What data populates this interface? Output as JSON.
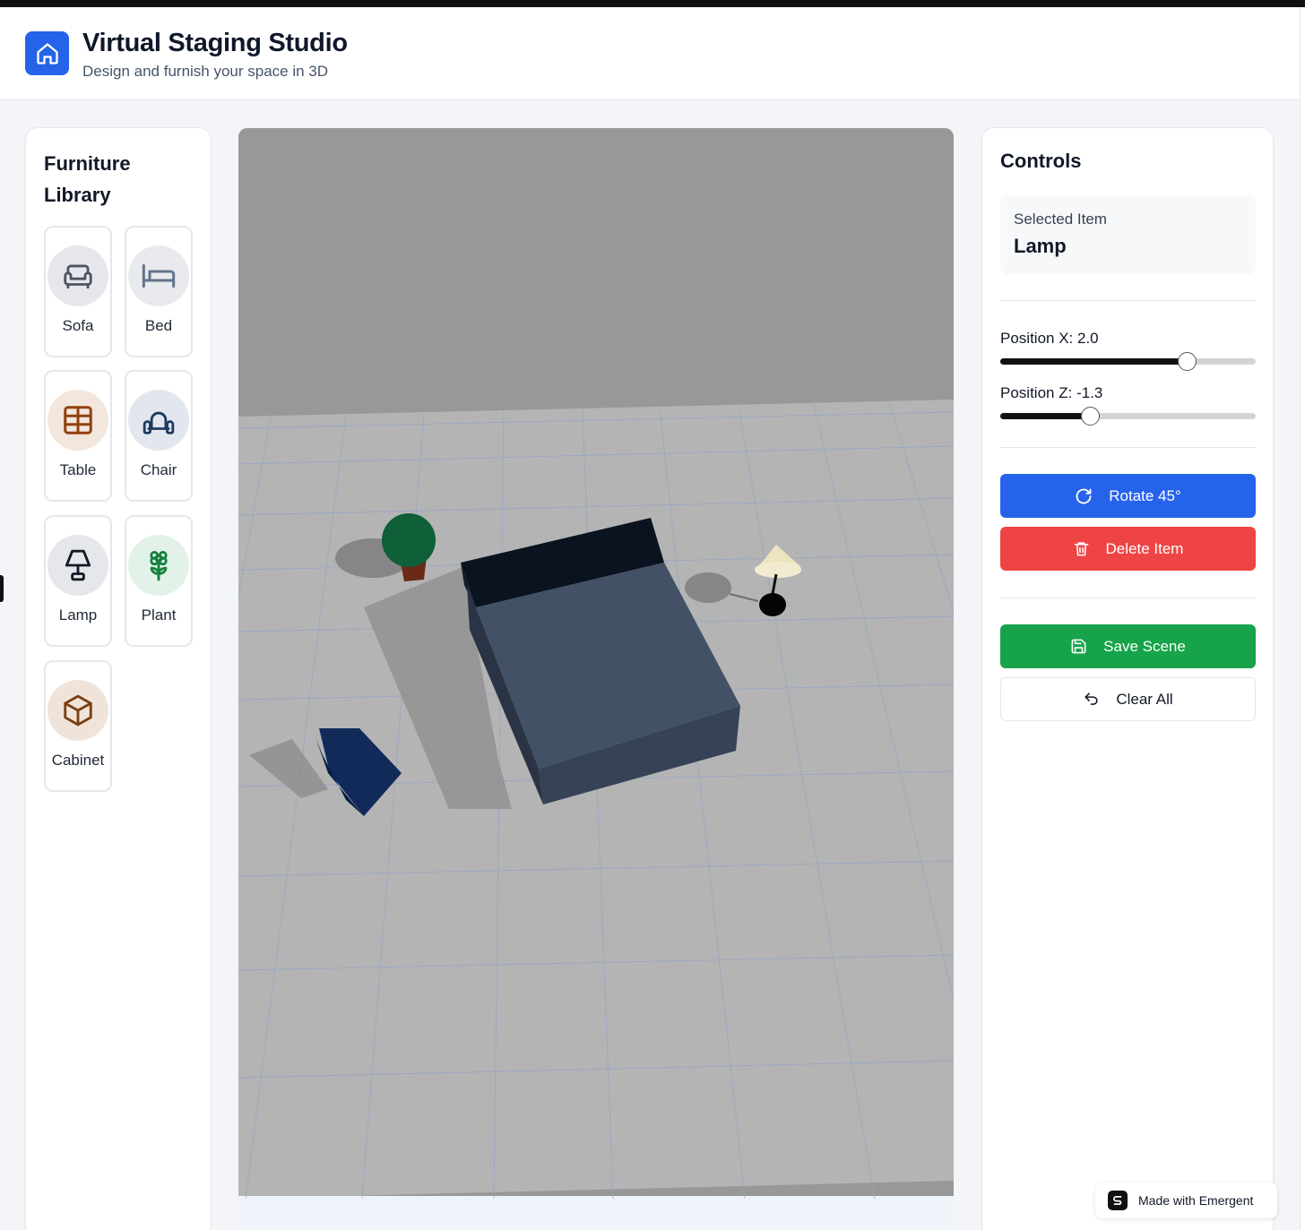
{
  "header": {
    "title": "Virtual Staging Studio",
    "subtitle": "Design and furnish your space in 3D",
    "logo_icon": "home-icon"
  },
  "library": {
    "title": "Furniture Library",
    "items": [
      {
        "label": "Sofa",
        "icon": "sofa-icon",
        "color": "#4b5563",
        "bg": "#e5e7eb"
      },
      {
        "label": "Bed",
        "icon": "bed-icon",
        "color": "#64748b",
        "bg": "#e8eaee"
      },
      {
        "label": "Table",
        "icon": "table-icon",
        "color": "#92400e",
        "bg": "#f3e6dc"
      },
      {
        "label": "Chair",
        "icon": "chair-icon",
        "color": "#1e3a5f",
        "bg": "#e2e6ee"
      },
      {
        "label": "Lamp",
        "icon": "lamp-icon",
        "color": "#111827",
        "bg": "#e5e7eb"
      },
      {
        "label": "Plant",
        "icon": "flower-icon",
        "color": "#15803d",
        "bg": "#e3f2e8"
      },
      {
        "label": "Cabinet",
        "icon": "box-icon",
        "color": "#7c3f12",
        "bg": "#f0e4da"
      }
    ]
  },
  "controls": {
    "title": "Controls",
    "selected_label": "Selected Item",
    "selected_value": "Lamp",
    "position_x": {
      "label": "Position X: 2.0",
      "value": 2.0,
      "fraction": 0.73
    },
    "position_z": {
      "label": "Position Z: -1.3",
      "value": -1.3,
      "fraction": 0.35
    },
    "rotate_label": "Rotate 45°",
    "delete_label": "Delete Item",
    "save_label": "Save Scene",
    "clear_label": "Clear All"
  },
  "colors": {
    "accent_blue": "#2563eb",
    "danger_red": "#ef4444",
    "success_green": "#16a34a"
  },
  "badge": {
    "label": "Made with Emergent"
  }
}
